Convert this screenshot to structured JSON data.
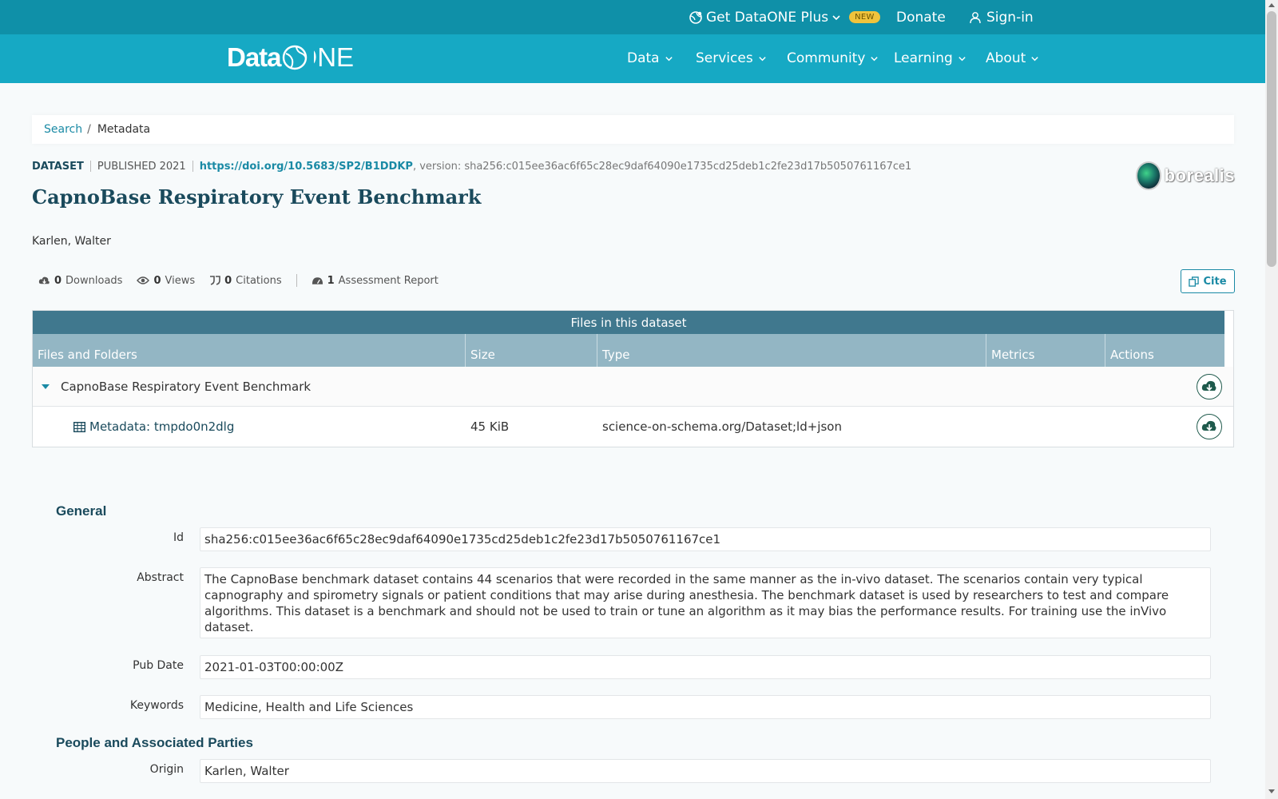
{
  "topbar": {
    "plus_label": "Get DataONE Plus",
    "plus_badge": "NEW",
    "donate": "Donate",
    "signin": "Sign-in"
  },
  "logo": {
    "part1": "Data",
    "part2": "ONE"
  },
  "nav": {
    "items": [
      {
        "label": "Data"
      },
      {
        "label": "Services"
      },
      {
        "label": "Community"
      },
      {
        "label": "Learning"
      },
      {
        "label": "About"
      }
    ]
  },
  "breadcrumb": {
    "search": "Search",
    "sep": "/",
    "current": "Metadata"
  },
  "dataset": {
    "type": "DATASET",
    "published": "PUBLISHED 2021",
    "doi": "https://doi.org/10.5683/SP2/B1DDKP",
    "version": ", version: sha256:c015ee36ac6f65c28ec9daf64090e1735cd25deb1c2fe23d17b5050761167ce1",
    "title": "CapnoBase Respiratory Event Benchmark",
    "author": "Karlen, Walter",
    "repository_logo": "borealis"
  },
  "stats": {
    "downloads_count": "0",
    "downloads_label": "Downloads",
    "views_count": "0",
    "views_label": "Views",
    "citations_count": "0",
    "citations_label": "Citations",
    "assessment_count": "1",
    "assessment_label": "Assessment Report",
    "cite_label": "Cite"
  },
  "files": {
    "header": "Files in this dataset",
    "columns": [
      "Files and Folders",
      "Size",
      "Type",
      "Metrics",
      "Actions"
    ],
    "folder_name": "CapnoBase Respiratory Event Benchmark",
    "rows": [
      {
        "name": "Metadata: tmpdo0n2dlg",
        "size": "45 KiB",
        "type": "science-on-schema.org/Dataset;ld+json"
      }
    ]
  },
  "general": {
    "title": "General",
    "id_label": "Id",
    "id_value": "sha256:c015ee36ac6f65c28ec9daf64090e1735cd25deb1c2fe23d17b5050761167ce1",
    "abstract_label": "Abstract",
    "abstract_value": "The CapnoBase benchmark dataset contains 44 scenarios that were recorded in the same manner as the in-vivo dataset. The scenarios contain very typical capnography and spirometry signals or patient conditions that may arise during anesthesia. The benchmark dataset is used by researchers to test and compare algorithms. This dataset is a benchmark and should not be used to train or tune an algorithm as it may bias the performance results. For training use the inVivo dataset.",
    "pubdate_label": "Pub Date",
    "pubdate_value": "2021-01-03T00:00:00Z",
    "keywords_label": "Keywords",
    "keywords_value": "Medicine, Health and Life Sciences"
  },
  "people": {
    "title": "People and Associated Parties",
    "origin_label": "Origin",
    "origin_value": "Karlen, Walter"
  },
  "colors": {
    "topbar": "#0f90a8",
    "nav": "#16a9c4",
    "title": "#1a4a5c",
    "link": "#1a8aa5",
    "table_header": "#40788e",
    "table_columns": "#93b6c4"
  }
}
